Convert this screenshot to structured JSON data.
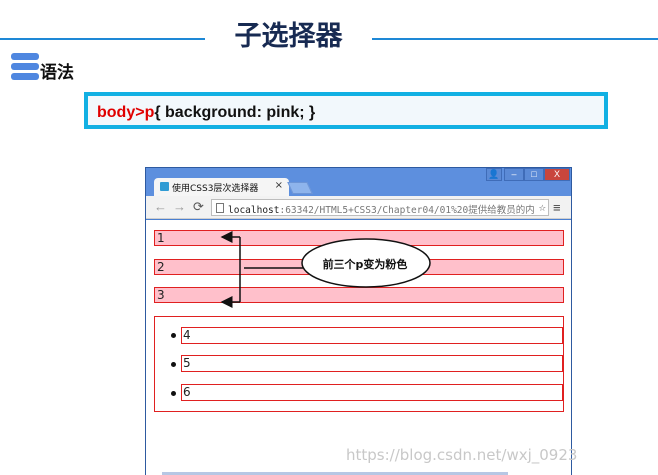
{
  "slide": {
    "title": "子选择器",
    "section_label": "语法",
    "code_selector": "body>p",
    "code_rule": "{  background: pink;  }"
  },
  "browser": {
    "tab_title": "使用CSS3层次选择器",
    "tab_close": "×",
    "url_host": "localhost",
    "url_path": ":63342/HTML5+CSS3/Chapter04/01%20提供给教员的内",
    "controls": {
      "user": "👤",
      "minimize": "–",
      "maximize": "□",
      "close": "X"
    }
  },
  "page": {
    "paragraphs": [
      "1",
      "2",
      "3"
    ],
    "list_items": [
      "4",
      "5",
      "6"
    ]
  },
  "annotation": {
    "text": "前三个p变为粉色"
  },
  "watermark": "https://blog.csdn.net/wxj_0923",
  "colors": {
    "accent": "#1e88d6",
    "code_border": "#12b0e3",
    "pink": "#ffc0cb",
    "red_border": "#e02020",
    "selector_red": "#e00000"
  }
}
